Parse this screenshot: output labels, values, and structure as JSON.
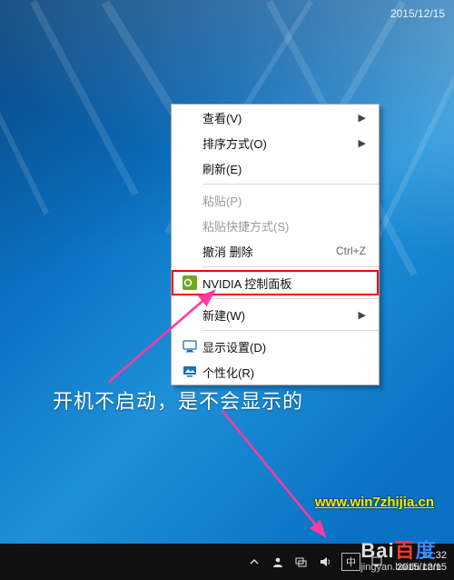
{
  "corner_date": "2015/12/15",
  "menu": {
    "view": "查看(V)",
    "sort": "排序方式(O)",
    "refresh": "刷新(E)",
    "paste": "粘贴(P)",
    "paste_shortcut": "粘贴快捷方式(S)",
    "undo": "撤消 删除",
    "undo_sc": "Ctrl+Z",
    "nvidia": "NVIDIA 控制面板",
    "new": "新建(W)",
    "display": "显示设置(D)",
    "personalize": "个性化(R)"
  },
  "annotation": "开机不启动，是不会显示的",
  "watermark_link": "www.win7zhijia.cn",
  "taskbar": {
    "ime": "中",
    "time": "21:32",
    "date": "2015/12/15"
  },
  "baidu": {
    "logo": "Bai百度",
    "sub": "jingyan.baidu.com"
  }
}
